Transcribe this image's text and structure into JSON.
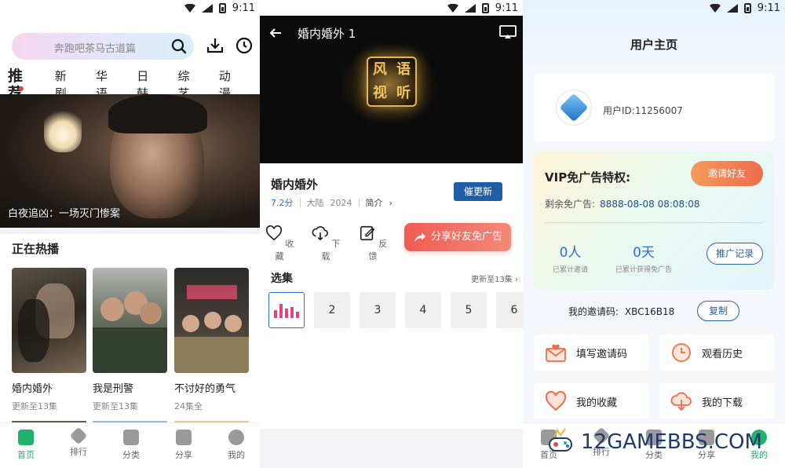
{
  "status": {
    "time": "9:11"
  },
  "home": {
    "search_placeholder": "奔跑吧茶马古道篇",
    "categories": [
      "推荐",
      "新剧",
      "华语",
      "日韩",
      "综艺",
      "动漫"
    ],
    "banner_caption": "白夜追凶：一场灭门惨案",
    "section_title": "正在热播",
    "cards": [
      {
        "title": "婚内婚外",
        "sub": "更新至13集"
      },
      {
        "title": "我是刑警",
        "sub": "更新至13集"
      },
      {
        "title": "不讨好的勇气",
        "sub": "24集全"
      }
    ],
    "tabs": [
      "首页",
      "排行",
      "分类",
      "分享",
      "我的"
    ]
  },
  "player": {
    "title": "婚内婚外 1",
    "name": "婚内婚外",
    "score": "7.2分",
    "region": "大陆",
    "year": "2024",
    "intro": "简介",
    "update_btn": "催更新",
    "actions": [
      "收藏",
      "下载",
      "反馈"
    ],
    "share_btn": "分享好友免广告",
    "episodes_title": "选集",
    "episodes_more": "更新至13集",
    "episodes": [
      "2",
      "3",
      "4",
      "5",
      "6"
    ],
    "logo_chars": [
      "风",
      "语",
      "视",
      "听"
    ]
  },
  "profile": {
    "title": "用户主页",
    "user_id": "用户ID:11256007",
    "vip_title": "VIP免广告特权:",
    "invite_btn": "邀请好友",
    "remain_label": "剩余免广告:",
    "remain_value": "8888-08-08 08:08:08",
    "stat1_value": "0人",
    "stat1_label": "已累计邀请",
    "stat2_value": "0天",
    "stat2_label": "已累计获得免广告",
    "promote_btn": "推广记录",
    "invite_code_label": "我的邀请码:",
    "invite_code": "XBC16B18",
    "copy_btn": "复制",
    "tiles": [
      "填写邀请码",
      "观看历史",
      "我的收藏",
      "我的下载"
    ],
    "tabs": [
      "首页",
      "排行",
      "分类",
      "分享",
      "我的"
    ]
  },
  "watermark": "12GAMEBBS.COM",
  "colors": {
    "accent_green": "#1fb36e",
    "accent_blue": "#1e5fa8",
    "accent_red": "#ef5b55"
  }
}
